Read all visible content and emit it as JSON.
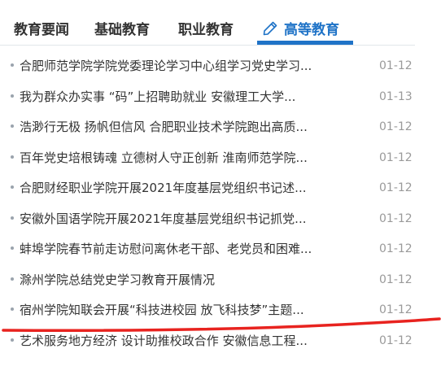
{
  "tabs": [
    {
      "label": "教育要闻"
    },
    {
      "label": "基础教育"
    },
    {
      "label": "职业教育"
    },
    {
      "label": "高等教育",
      "active": true,
      "icon": "pencil-icon"
    }
  ],
  "colors": {
    "accent": "#1f73c7",
    "annotation": "#e8231f"
  },
  "news": [
    {
      "title": "合肥师范学院学院党委理论学习中心组学习党史学习...",
      "date": "01-12"
    },
    {
      "title": "我为群众办实事 “码”上招聘助就业 安徽理工大学...",
      "date": "01-13"
    },
    {
      "title": "浩渺行无极 扬帆但信风 合肥职业技术学院跑出高质...",
      "date": "01-12"
    },
    {
      "title": "百年党史培根铸魂 立德树人守正创新 淮南师范学院...",
      "date": "01-12"
    },
    {
      "title": "合肥财经职业学院开展2021年度基层党组织书记述...",
      "date": "01-12"
    },
    {
      "title": "安徽外国语学院开展2021年度基层党组织书记抓党...",
      "date": "01-12"
    },
    {
      "title": "蚌埠学院春节前走访慰问离休老干部、老党员和困难...",
      "date": "01-12"
    },
    {
      "title": "滁州学院总结党史学习教育开展情况",
      "date": "01-12"
    },
    {
      "title": "宿州学院知联会开展“科技进校园 放飞科技梦”主题...",
      "date": "01-12"
    },
    {
      "title": "艺术服务地方经济 设计助推校政合作 安徽信息工程...",
      "date": "01-12"
    }
  ]
}
